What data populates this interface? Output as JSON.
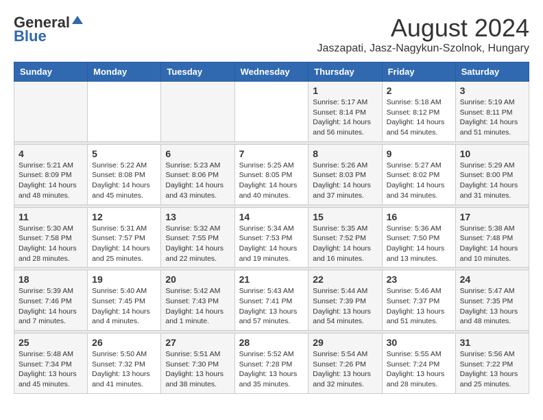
{
  "header": {
    "logo_general": "General",
    "logo_blue": "Blue",
    "month_year": "August 2024",
    "location": "Jaszapati, Jasz-Nagykun-Szolnok, Hungary"
  },
  "days_of_week": [
    "Sunday",
    "Monday",
    "Tuesday",
    "Wednesday",
    "Thursday",
    "Friday",
    "Saturday"
  ],
  "weeks": [
    {
      "days": [
        {
          "number": "",
          "info": ""
        },
        {
          "number": "",
          "info": ""
        },
        {
          "number": "",
          "info": ""
        },
        {
          "number": "",
          "info": ""
        },
        {
          "number": "1",
          "info": "Sunrise: 5:17 AM\nSunset: 8:14 PM\nDaylight: 14 hours\nand 56 minutes."
        },
        {
          "number": "2",
          "info": "Sunrise: 5:18 AM\nSunset: 8:12 PM\nDaylight: 14 hours\nand 54 minutes."
        },
        {
          "number": "3",
          "info": "Sunrise: 5:19 AM\nSunset: 8:11 PM\nDaylight: 14 hours\nand 51 minutes."
        }
      ]
    },
    {
      "days": [
        {
          "number": "4",
          "info": "Sunrise: 5:21 AM\nSunset: 8:09 PM\nDaylight: 14 hours\nand 48 minutes."
        },
        {
          "number": "5",
          "info": "Sunrise: 5:22 AM\nSunset: 8:08 PM\nDaylight: 14 hours\nand 45 minutes."
        },
        {
          "number": "6",
          "info": "Sunrise: 5:23 AM\nSunset: 8:06 PM\nDaylight: 14 hours\nand 43 minutes."
        },
        {
          "number": "7",
          "info": "Sunrise: 5:25 AM\nSunset: 8:05 PM\nDaylight: 14 hours\nand 40 minutes."
        },
        {
          "number": "8",
          "info": "Sunrise: 5:26 AM\nSunset: 8:03 PM\nDaylight: 14 hours\nand 37 minutes."
        },
        {
          "number": "9",
          "info": "Sunrise: 5:27 AM\nSunset: 8:02 PM\nDaylight: 14 hours\nand 34 minutes."
        },
        {
          "number": "10",
          "info": "Sunrise: 5:29 AM\nSunset: 8:00 PM\nDaylight: 14 hours\nand 31 minutes."
        }
      ]
    },
    {
      "days": [
        {
          "number": "11",
          "info": "Sunrise: 5:30 AM\nSunset: 7:58 PM\nDaylight: 14 hours\nand 28 minutes."
        },
        {
          "number": "12",
          "info": "Sunrise: 5:31 AM\nSunset: 7:57 PM\nDaylight: 14 hours\nand 25 minutes."
        },
        {
          "number": "13",
          "info": "Sunrise: 5:32 AM\nSunset: 7:55 PM\nDaylight: 14 hours\nand 22 minutes."
        },
        {
          "number": "14",
          "info": "Sunrise: 5:34 AM\nSunset: 7:53 PM\nDaylight: 14 hours\nand 19 minutes."
        },
        {
          "number": "15",
          "info": "Sunrise: 5:35 AM\nSunset: 7:52 PM\nDaylight: 14 hours\nand 16 minutes."
        },
        {
          "number": "16",
          "info": "Sunrise: 5:36 AM\nSunset: 7:50 PM\nDaylight: 14 hours\nand 13 minutes."
        },
        {
          "number": "17",
          "info": "Sunrise: 5:38 AM\nSunset: 7:48 PM\nDaylight: 14 hours\nand 10 minutes."
        }
      ]
    },
    {
      "days": [
        {
          "number": "18",
          "info": "Sunrise: 5:39 AM\nSunset: 7:46 PM\nDaylight: 14 hours\nand 7 minutes."
        },
        {
          "number": "19",
          "info": "Sunrise: 5:40 AM\nSunset: 7:45 PM\nDaylight: 14 hours\nand 4 minutes."
        },
        {
          "number": "20",
          "info": "Sunrise: 5:42 AM\nSunset: 7:43 PM\nDaylight: 14 hours\nand 1 minute."
        },
        {
          "number": "21",
          "info": "Sunrise: 5:43 AM\nSunset: 7:41 PM\nDaylight: 13 hours\nand 57 minutes."
        },
        {
          "number": "22",
          "info": "Sunrise: 5:44 AM\nSunset: 7:39 PM\nDaylight: 13 hours\nand 54 minutes."
        },
        {
          "number": "23",
          "info": "Sunrise: 5:46 AM\nSunset: 7:37 PM\nDaylight: 13 hours\nand 51 minutes."
        },
        {
          "number": "24",
          "info": "Sunrise: 5:47 AM\nSunset: 7:35 PM\nDaylight: 13 hours\nand 48 minutes."
        }
      ]
    },
    {
      "days": [
        {
          "number": "25",
          "info": "Sunrise: 5:48 AM\nSunset: 7:34 PM\nDaylight: 13 hours\nand 45 minutes."
        },
        {
          "number": "26",
          "info": "Sunrise: 5:50 AM\nSunset: 7:32 PM\nDaylight: 13 hours\nand 41 minutes."
        },
        {
          "number": "27",
          "info": "Sunrise: 5:51 AM\nSunset: 7:30 PM\nDaylight: 13 hours\nand 38 minutes."
        },
        {
          "number": "28",
          "info": "Sunrise: 5:52 AM\nSunset: 7:28 PM\nDaylight: 13 hours\nand 35 minutes."
        },
        {
          "number": "29",
          "info": "Sunrise: 5:54 AM\nSunset: 7:26 PM\nDaylight: 13 hours\nand 32 minutes."
        },
        {
          "number": "30",
          "info": "Sunrise: 5:55 AM\nSunset: 7:24 PM\nDaylight: 13 hours\nand 28 minutes."
        },
        {
          "number": "31",
          "info": "Sunrise: 5:56 AM\nSunset: 7:22 PM\nDaylight: 13 hours\nand 25 minutes."
        }
      ]
    }
  ]
}
